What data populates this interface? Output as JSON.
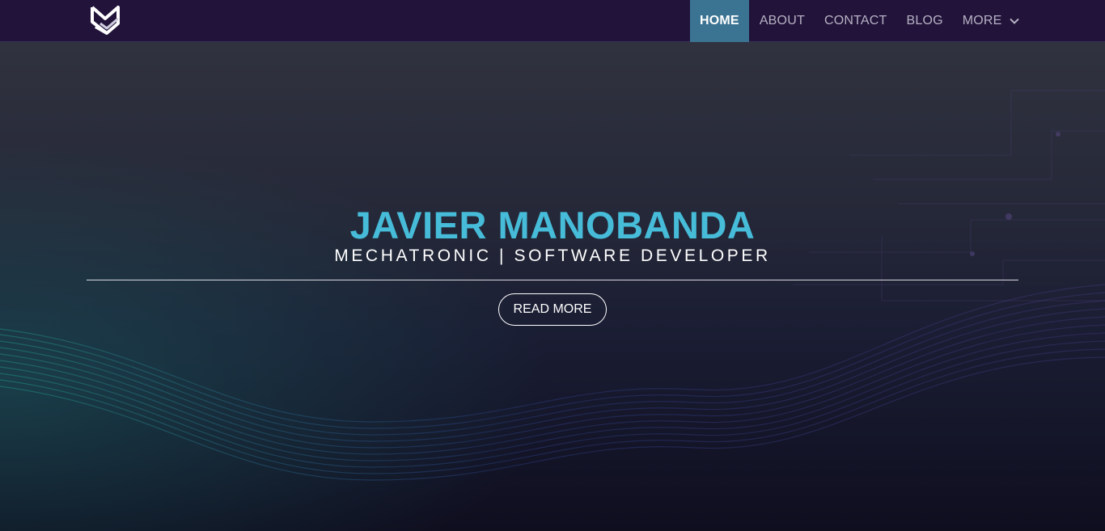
{
  "brand": {
    "logo_icon": "mj-monogram-logo"
  },
  "nav": {
    "items": [
      {
        "label": "HOME",
        "active": true
      },
      {
        "label": "ABOUT",
        "active": false
      },
      {
        "label": "CONTACT",
        "active": false
      },
      {
        "label": "BLOG",
        "active": false
      },
      {
        "label": "MORE",
        "active": false,
        "icon": "chevron-down-icon"
      }
    ]
  },
  "hero": {
    "title": "JAVIER MANOBANDA",
    "subtitle": "MECHATRONIC | SOFTWARE DEVELOPER",
    "cta_label": "READ MORE"
  },
  "colors": {
    "navbar_bg": "#22133a",
    "active_tab_bg": "#3b7392",
    "title_accent": "#46bcd9",
    "hero_bg_top": "#30323f",
    "hero_bg_bottom": "#0f0e1f"
  }
}
